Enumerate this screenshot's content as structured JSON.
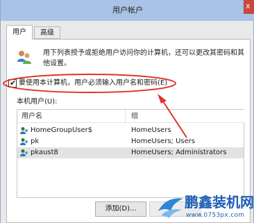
{
  "window": {
    "title": "用户帐户",
    "close_glyph": "x"
  },
  "tabs": [
    {
      "label": "用户",
      "active": true
    },
    {
      "label": "高级",
      "active": false
    }
  ],
  "intro_text": "用下列表授予或拒绝用户访问你的计算机，还可以更改其密码和其他设置。",
  "checkbox": {
    "checked": true,
    "glyph": "✔",
    "label": "要使用本计算机，用户必须输入用户名和密码(E)"
  },
  "machine_users_label": "本机用户(U):",
  "table": {
    "columns": [
      "用户名",
      "组"
    ],
    "rows": [
      {
        "name": "HomeGroupUser$",
        "group": "HomeUsers",
        "selected": false
      },
      {
        "name": "pk",
        "group": "HomeUsers; Users",
        "selected": false
      },
      {
        "name": "pkaust8",
        "group": "HomeUsers; Administrators",
        "selected": true
      }
    ]
  },
  "buttons": {
    "add_label": "添加(D)...",
    "remove_label": ""
  },
  "watermark": {
    "brand_text": "鹏鑫装机网",
    "url": "www.0753px.com",
    "color": "#1f5fb5"
  },
  "annotation_color": "#e0322c"
}
